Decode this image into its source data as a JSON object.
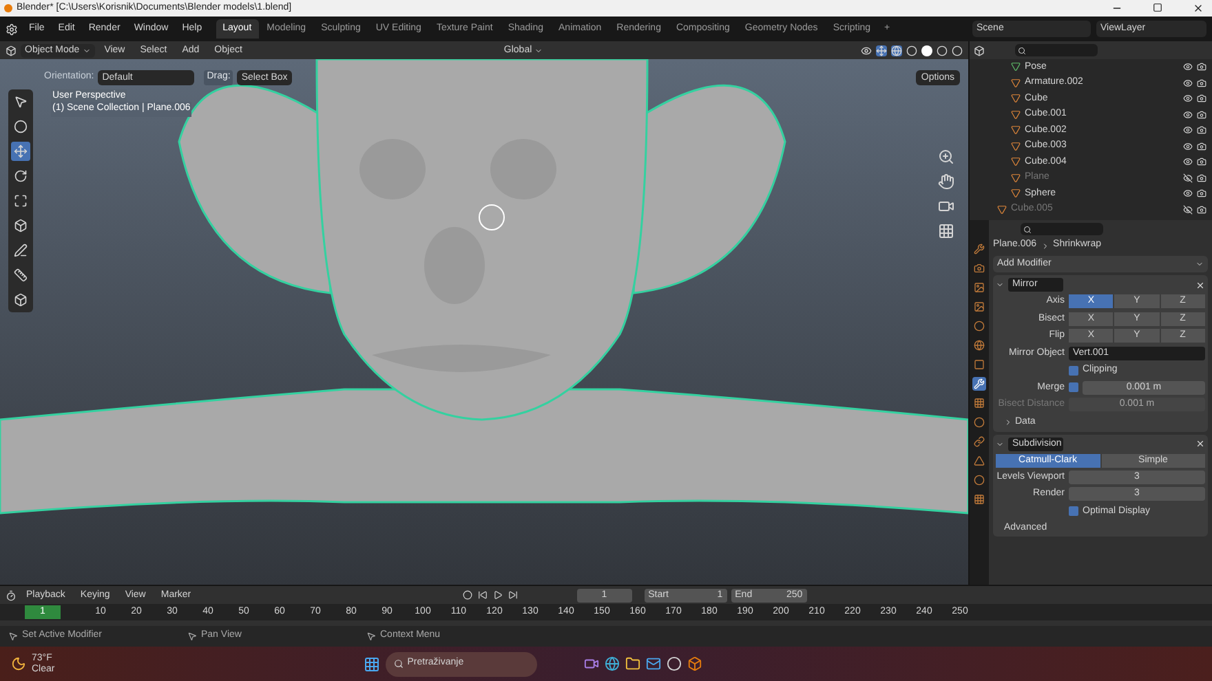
{
  "window": {
    "title": "Blender* [C:\\Users\\Korisnik\\Documents\\Blender models\\1.blend]"
  },
  "menu": [
    "File",
    "Edit",
    "Render",
    "Window",
    "Help"
  ],
  "workspaces": [
    {
      "label": "Layout",
      "selected": true
    },
    {
      "label": "Modeling",
      "selected": false
    },
    {
      "label": "Sculpting",
      "selected": false
    },
    {
      "label": "UV Editing",
      "selected": false
    },
    {
      "label": "Texture Paint",
      "selected": false
    },
    {
      "label": "Shading",
      "selected": false
    },
    {
      "label": "Animation",
      "selected": false
    },
    {
      "label": "Rendering",
      "selected": false
    },
    {
      "label": "Compositing",
      "selected": false
    },
    {
      "label": "Geometry Nodes",
      "selected": false
    },
    {
      "label": "Scripting",
      "selected": false
    }
  ],
  "add_workspace": "+",
  "scene": "Scene",
  "view_layer": "ViewLayer",
  "viewport_header": {
    "mode": "Object Mode",
    "menus": [
      "View",
      "Select",
      "Add",
      "Object"
    ],
    "transform": "Global"
  },
  "tool_settings": {
    "orientation_label": "Orientation:",
    "orientation": "Default",
    "drag_label": "Drag:",
    "drag": "Select Box",
    "options": "Options"
  },
  "viewport": {
    "perspective": "User Perspective",
    "collection": "(1) Scene Collection | Plane.006"
  },
  "outliner": {
    "items": [
      {
        "name": "Pose",
        "kind": "pose",
        "visible": true
      },
      {
        "name": "Armature.002",
        "kind": "armature",
        "visible": true
      },
      {
        "name": "Cube",
        "kind": "mesh",
        "visible": true
      },
      {
        "name": "Cube.001",
        "kind": "mesh",
        "visible": true
      },
      {
        "name": "Cube.002",
        "kind": "mesh",
        "visible": true
      },
      {
        "name": "Cube.003",
        "kind": "mesh",
        "visible": true
      },
      {
        "name": "Cube.004",
        "kind": "mesh",
        "visible": true
      },
      {
        "name": "Plane",
        "kind": "mesh",
        "visible": false
      },
      {
        "name": "Sphere",
        "kind": "mesh",
        "visible": true
      }
    ],
    "lower_items": [
      {
        "name": "Cube.005",
        "kind": "mesh",
        "visible": false
      }
    ]
  },
  "properties": {
    "object": "Plane.006",
    "modifier": "Shrinkwrap",
    "add_modifier": "Add Modifier",
    "tabs": [
      {
        "kind": "tool",
        "selected": false
      },
      {
        "kind": "render",
        "selected": false
      },
      {
        "kind": "output",
        "selected": false
      },
      {
        "kind": "view",
        "selected": false
      },
      {
        "kind": "scene",
        "selected": false
      },
      {
        "kind": "world",
        "selected": false
      },
      {
        "kind": "object",
        "selected": false
      },
      {
        "kind": "modifier",
        "selected": true
      },
      {
        "kind": "particles",
        "selected": false
      },
      {
        "kind": "physics",
        "selected": false
      },
      {
        "kind": "constraints",
        "selected": false
      },
      {
        "kind": "data",
        "selected": false
      },
      {
        "kind": "material",
        "selected": false
      },
      {
        "kind": "texture",
        "selected": false
      }
    ],
    "mirror": {
      "name": "Mirror",
      "rows": [
        {
          "label": "Axis",
          "options": [
            {
              "label": "X",
              "selected": true
            },
            {
              "label": "Y",
              "selected": false
            },
            {
              "label": "Z",
              "selected": false
            }
          ]
        },
        {
          "label": "Bisect",
          "options": [
            {
              "label": "X",
              "selected": false
            },
            {
              "label": "Y",
              "selected": false
            },
            {
              "label": "Z",
              "selected": false
            }
          ]
        },
        {
          "label": "Flip",
          "options": [
            {
              "label": "X",
              "selected": false
            },
            {
              "label": "Y",
              "selected": false
            },
            {
              "label": "Z",
              "selected": false
            }
          ]
        }
      ],
      "mirror_object_label": "Mirror Object",
      "mirror_object": "Vert.001",
      "clipping": {
        "label": "Clipping",
        "checked": true
      },
      "merge": {
        "label": "Merge",
        "checked": true,
        "value": "0.001 m"
      },
      "bisect_distance": {
        "label": "Bisect Distance",
        "value": "0.001 m",
        "disabled": true
      },
      "data": {
        "label": "Data",
        "expanded": false
      }
    },
    "subdivision": {
      "name": "Subdivision",
      "methods": [
        {
          "label": "Catmull-Clark",
          "selected": true
        },
        {
          "label": "Simple",
          "selected": false
        }
      ],
      "fields": [
        {
          "label": "Levels Viewport",
          "value": "3"
        },
        {
          "label": "Render",
          "value": "3"
        }
      ],
      "optimal_display": {
        "label": "Optimal Display",
        "checked": true
      },
      "advanced": "Advanced"
    }
  },
  "timeline": {
    "menus": [
      "Playback",
      "Keying",
      "View",
      "Marker"
    ],
    "current": "1",
    "start_label": "Start",
    "start": "1",
    "end_label": "End",
    "end": "250",
    "frames": [
      {
        "label": "1",
        "selected": true
      },
      {
        "label": "10",
        "selected": false
      },
      {
        "label": "20",
        "selected": false
      },
      {
        "label": "30",
        "selected": false
      },
      {
        "label": "40",
        "selected": false
      },
      {
        "label": "50",
        "selected": false
      },
      {
        "label": "60",
        "selected": false
      },
      {
        "label": "70",
        "selected": false
      },
      {
        "label": "80",
        "selected": false
      },
      {
        "label": "90",
        "selected": false
      },
      {
        "label": "100",
        "selected": false
      },
      {
        "label": "110",
        "selected": false
      },
      {
        "label": "120",
        "selected": false
      },
      {
        "label": "130",
        "selected": false
      },
      {
        "label": "140",
        "selected": false
      },
      {
        "label": "150",
        "selected": false
      },
      {
        "label": "160",
        "selected": false
      },
      {
        "label": "170",
        "selected": false
      },
      {
        "label": "180",
        "selected": false
      },
      {
        "label": "190",
        "selected": false
      },
      {
        "label": "200",
        "selected": false
      },
      {
        "label": "210",
        "selected": false
      },
      {
        "label": "220",
        "selected": false
      },
      {
        "label": "230",
        "selected": false
      },
      {
        "label": "240",
        "selected": false
      },
      {
        "label": "250",
        "selected": false
      }
    ]
  },
  "status_bar": [
    "Set Active Modifier",
    "Pan View",
    "Context Menu"
  ],
  "taskbar": {
    "temperature": "73°F",
    "weather": "Clear",
    "search": "Pretraživanje"
  }
}
